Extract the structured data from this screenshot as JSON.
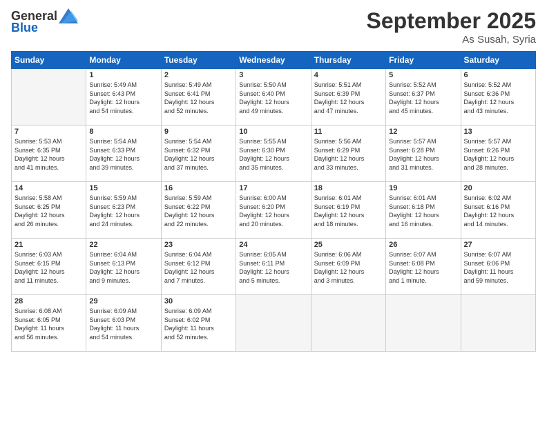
{
  "logo": {
    "text_general": "General",
    "text_blue": "Blue"
  },
  "header": {
    "month_title": "September 2025",
    "location": "As Susah, Syria"
  },
  "days_of_week": [
    "Sunday",
    "Monday",
    "Tuesday",
    "Wednesday",
    "Thursday",
    "Friday",
    "Saturday"
  ],
  "weeks": [
    [
      {
        "day": "",
        "info": ""
      },
      {
        "day": "1",
        "info": "Sunrise: 5:49 AM\nSunset: 6:43 PM\nDaylight: 12 hours\nand 54 minutes."
      },
      {
        "day": "2",
        "info": "Sunrise: 5:49 AM\nSunset: 6:41 PM\nDaylight: 12 hours\nand 52 minutes."
      },
      {
        "day": "3",
        "info": "Sunrise: 5:50 AM\nSunset: 6:40 PM\nDaylight: 12 hours\nand 49 minutes."
      },
      {
        "day": "4",
        "info": "Sunrise: 5:51 AM\nSunset: 6:39 PM\nDaylight: 12 hours\nand 47 minutes."
      },
      {
        "day": "5",
        "info": "Sunrise: 5:52 AM\nSunset: 6:37 PM\nDaylight: 12 hours\nand 45 minutes."
      },
      {
        "day": "6",
        "info": "Sunrise: 5:52 AM\nSunset: 6:36 PM\nDaylight: 12 hours\nand 43 minutes."
      }
    ],
    [
      {
        "day": "7",
        "info": "Sunrise: 5:53 AM\nSunset: 6:35 PM\nDaylight: 12 hours\nand 41 minutes."
      },
      {
        "day": "8",
        "info": "Sunrise: 5:54 AM\nSunset: 6:33 PM\nDaylight: 12 hours\nand 39 minutes."
      },
      {
        "day": "9",
        "info": "Sunrise: 5:54 AM\nSunset: 6:32 PM\nDaylight: 12 hours\nand 37 minutes."
      },
      {
        "day": "10",
        "info": "Sunrise: 5:55 AM\nSunset: 6:30 PM\nDaylight: 12 hours\nand 35 minutes."
      },
      {
        "day": "11",
        "info": "Sunrise: 5:56 AM\nSunset: 6:29 PM\nDaylight: 12 hours\nand 33 minutes."
      },
      {
        "day": "12",
        "info": "Sunrise: 5:57 AM\nSunset: 6:28 PM\nDaylight: 12 hours\nand 31 minutes."
      },
      {
        "day": "13",
        "info": "Sunrise: 5:57 AM\nSunset: 6:26 PM\nDaylight: 12 hours\nand 28 minutes."
      }
    ],
    [
      {
        "day": "14",
        "info": "Sunrise: 5:58 AM\nSunset: 6:25 PM\nDaylight: 12 hours\nand 26 minutes."
      },
      {
        "day": "15",
        "info": "Sunrise: 5:59 AM\nSunset: 6:23 PM\nDaylight: 12 hours\nand 24 minutes."
      },
      {
        "day": "16",
        "info": "Sunrise: 5:59 AM\nSunset: 6:22 PM\nDaylight: 12 hours\nand 22 minutes."
      },
      {
        "day": "17",
        "info": "Sunrise: 6:00 AM\nSunset: 6:20 PM\nDaylight: 12 hours\nand 20 minutes."
      },
      {
        "day": "18",
        "info": "Sunrise: 6:01 AM\nSunset: 6:19 PM\nDaylight: 12 hours\nand 18 minutes."
      },
      {
        "day": "19",
        "info": "Sunrise: 6:01 AM\nSunset: 6:18 PM\nDaylight: 12 hours\nand 16 minutes."
      },
      {
        "day": "20",
        "info": "Sunrise: 6:02 AM\nSunset: 6:16 PM\nDaylight: 12 hours\nand 14 minutes."
      }
    ],
    [
      {
        "day": "21",
        "info": "Sunrise: 6:03 AM\nSunset: 6:15 PM\nDaylight: 12 hours\nand 11 minutes."
      },
      {
        "day": "22",
        "info": "Sunrise: 6:04 AM\nSunset: 6:13 PM\nDaylight: 12 hours\nand 9 minutes."
      },
      {
        "day": "23",
        "info": "Sunrise: 6:04 AM\nSunset: 6:12 PM\nDaylight: 12 hours\nand 7 minutes."
      },
      {
        "day": "24",
        "info": "Sunrise: 6:05 AM\nSunset: 6:11 PM\nDaylight: 12 hours\nand 5 minutes."
      },
      {
        "day": "25",
        "info": "Sunrise: 6:06 AM\nSunset: 6:09 PM\nDaylight: 12 hours\nand 3 minutes."
      },
      {
        "day": "26",
        "info": "Sunrise: 6:07 AM\nSunset: 6:08 PM\nDaylight: 12 hours\nand 1 minute."
      },
      {
        "day": "27",
        "info": "Sunrise: 6:07 AM\nSunset: 6:06 PM\nDaylight: 11 hours\nand 59 minutes."
      }
    ],
    [
      {
        "day": "28",
        "info": "Sunrise: 6:08 AM\nSunset: 6:05 PM\nDaylight: 11 hours\nand 56 minutes."
      },
      {
        "day": "29",
        "info": "Sunrise: 6:09 AM\nSunset: 6:03 PM\nDaylight: 11 hours\nand 54 minutes."
      },
      {
        "day": "30",
        "info": "Sunrise: 6:09 AM\nSunset: 6:02 PM\nDaylight: 11 hours\nand 52 minutes."
      },
      {
        "day": "",
        "info": ""
      },
      {
        "day": "",
        "info": ""
      },
      {
        "day": "",
        "info": ""
      },
      {
        "day": "",
        "info": ""
      }
    ]
  ]
}
